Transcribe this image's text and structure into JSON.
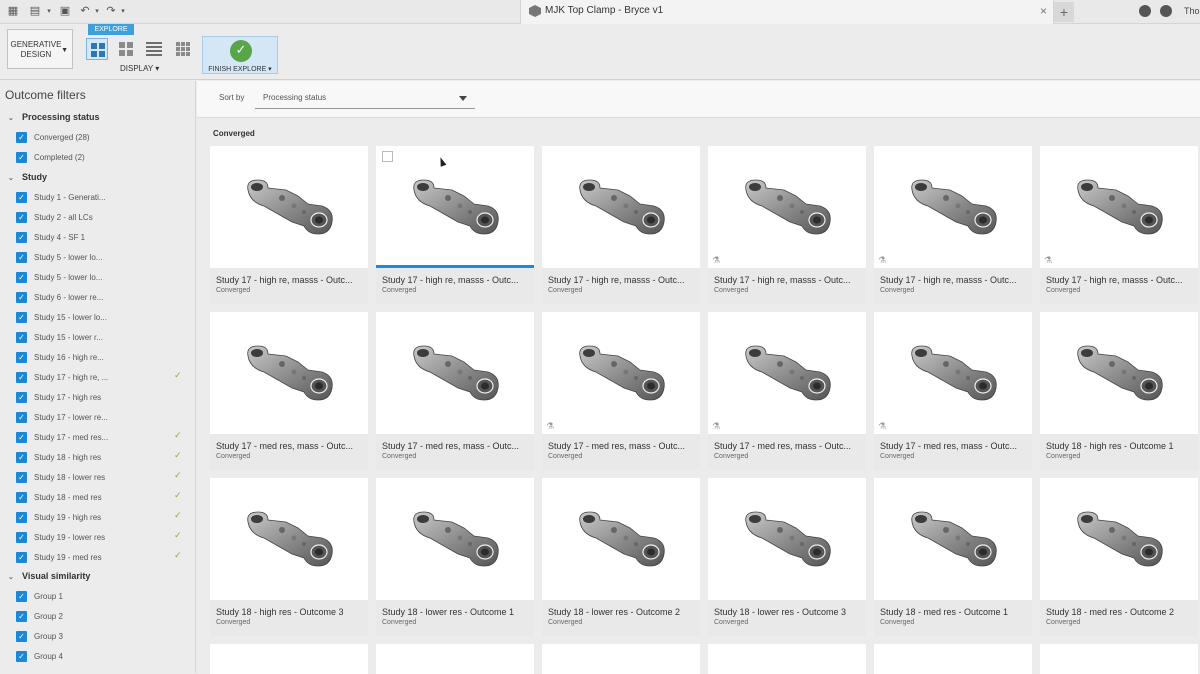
{
  "window": {
    "title": "MJK Top Clamp - Bryce v1",
    "user": "Tho",
    "new_tab": "+",
    "close_tab": "×"
  },
  "toolbar": {
    "generative_design": "GENERATIVE DESIGN",
    "explore_tab": "EXPLORE",
    "display_label": "DISPLAY ▾",
    "finish_explore": "FINISH EXPLORE ▾",
    "finish_icon": "✓"
  },
  "sidebar": {
    "title": "Outcome filters",
    "sections": {
      "processing": "Processing status",
      "study": "Study",
      "visual": "Visual similarity"
    },
    "processing_items": [
      {
        "label": "Converged (28)"
      },
      {
        "label": "Completed (2)"
      }
    ],
    "study_items": [
      {
        "label": "Study 1 - Generati...",
        "ok": ""
      },
      {
        "label": "Study 2 - all LCs",
        "ok": ""
      },
      {
        "label": "Study 4 - SF 1",
        "ok": ""
      },
      {
        "label": "Study 5 - lower lo...",
        "ok": ""
      },
      {
        "label": "Study 5 - lower lo...",
        "ok": ""
      },
      {
        "label": "Study 6 - lower re...",
        "ok": ""
      },
      {
        "label": "Study 15 - lower lo...",
        "ok": ""
      },
      {
        "label": "Study 15 - lower r...",
        "ok": ""
      },
      {
        "label": "Study 16 - high re...",
        "ok": ""
      },
      {
        "label": "Study 17 - high re, ...",
        "ok": "✓"
      },
      {
        "label": "Study 17 - high res",
        "ok": ""
      },
      {
        "label": "Study 17 - lower re...",
        "ok": ""
      },
      {
        "label": "Study 17 - med res...",
        "ok": "✓"
      },
      {
        "label": "Study 18 - high res",
        "ok": "✓"
      },
      {
        "label": "Study 18 - lower res",
        "ok": "✓"
      },
      {
        "label": "Study 18 - med res",
        "ok": "✓"
      },
      {
        "label": "Study 19 - high res",
        "ok": "✓"
      },
      {
        "label": "Study 19 - lower res",
        "ok": "✓"
      },
      {
        "label": "Study 19 - med res",
        "ok": "✓"
      }
    ],
    "visual_items": [
      {
        "label": "Group 1"
      },
      {
        "label": "Group 2"
      },
      {
        "label": "Group 3"
      },
      {
        "label": "Group 4"
      }
    ],
    "check_glyph": "✓",
    "chevron": "⌄"
  },
  "main": {
    "sort_label": "Sort by",
    "sort_value": "Processing status",
    "group_label": "Converged",
    "cards": [
      {
        "name": "Study 17 - high re, masss - Outc...",
        "status": "Converged",
        "flask": "",
        "selected": false,
        "checkbox": false
      },
      {
        "name": "Study 17 - high re, masss - Outc...",
        "status": "Converged",
        "flask": "",
        "selected": true,
        "checkbox": true
      },
      {
        "name": "Study 17 - high re, masss - Outc...",
        "status": "Converged",
        "flask": "",
        "selected": false,
        "checkbox": false
      },
      {
        "name": "Study 17 - high re, masss - Outc...",
        "status": "Converged",
        "flask": "⚗",
        "selected": false,
        "checkbox": false
      },
      {
        "name": "Study 17 - high re, masss - Outc...",
        "status": "Converged",
        "flask": "⚗",
        "selected": false,
        "checkbox": false
      },
      {
        "name": "Study 17 - high re, masss - Outc...",
        "status": "Converged",
        "flask": "⚗",
        "selected": false,
        "checkbox": false
      },
      {
        "name": "Study 17 - med res, mass - Outc...",
        "status": "Converged",
        "flask": "",
        "selected": false,
        "checkbox": false
      },
      {
        "name": "Study 17 - med res, mass - Outc...",
        "status": "Converged",
        "flask": "",
        "selected": false,
        "checkbox": false
      },
      {
        "name": "Study 17 - med res, mass - Outc...",
        "status": "Converged",
        "flask": "⚗",
        "selected": false,
        "checkbox": false
      },
      {
        "name": "Study 17 - med res, mass - Outc...",
        "status": "Converged",
        "flask": "⚗",
        "selected": false,
        "checkbox": false
      },
      {
        "name": "Study 17 - med res, mass - Outc...",
        "status": "Converged",
        "flask": "⚗",
        "selected": false,
        "checkbox": false
      },
      {
        "name": "Study 18 - high res - Outcome 1",
        "status": "Converged",
        "flask": "",
        "selected": false,
        "checkbox": false
      },
      {
        "name": "Study 18 - high res - Outcome 3",
        "status": "Converged",
        "flask": "",
        "selected": false,
        "checkbox": false
      },
      {
        "name": "Study 18 - lower res - Outcome 1",
        "status": "Converged",
        "flask": "",
        "selected": false,
        "checkbox": false
      },
      {
        "name": "Study 18 - lower res - Outcome 2",
        "status": "Converged",
        "flask": "",
        "selected": false,
        "checkbox": false
      },
      {
        "name": "Study 18 - lower res - Outcome 3",
        "status": "Converged",
        "flask": "",
        "selected": false,
        "checkbox": false
      },
      {
        "name": "Study 18 - med res - Outcome 1",
        "status": "Converged",
        "flask": "",
        "selected": false,
        "checkbox": false
      },
      {
        "name": "Study 18 - med res - Outcome 2",
        "status": "Converged",
        "flask": "",
        "selected": false,
        "checkbox": false
      }
    ]
  },
  "colors": {
    "accent": "#1b8ad8",
    "checkbox": "#1d87d6",
    "ok_check": "#7ab042",
    "finish_green": "#58a648"
  }
}
